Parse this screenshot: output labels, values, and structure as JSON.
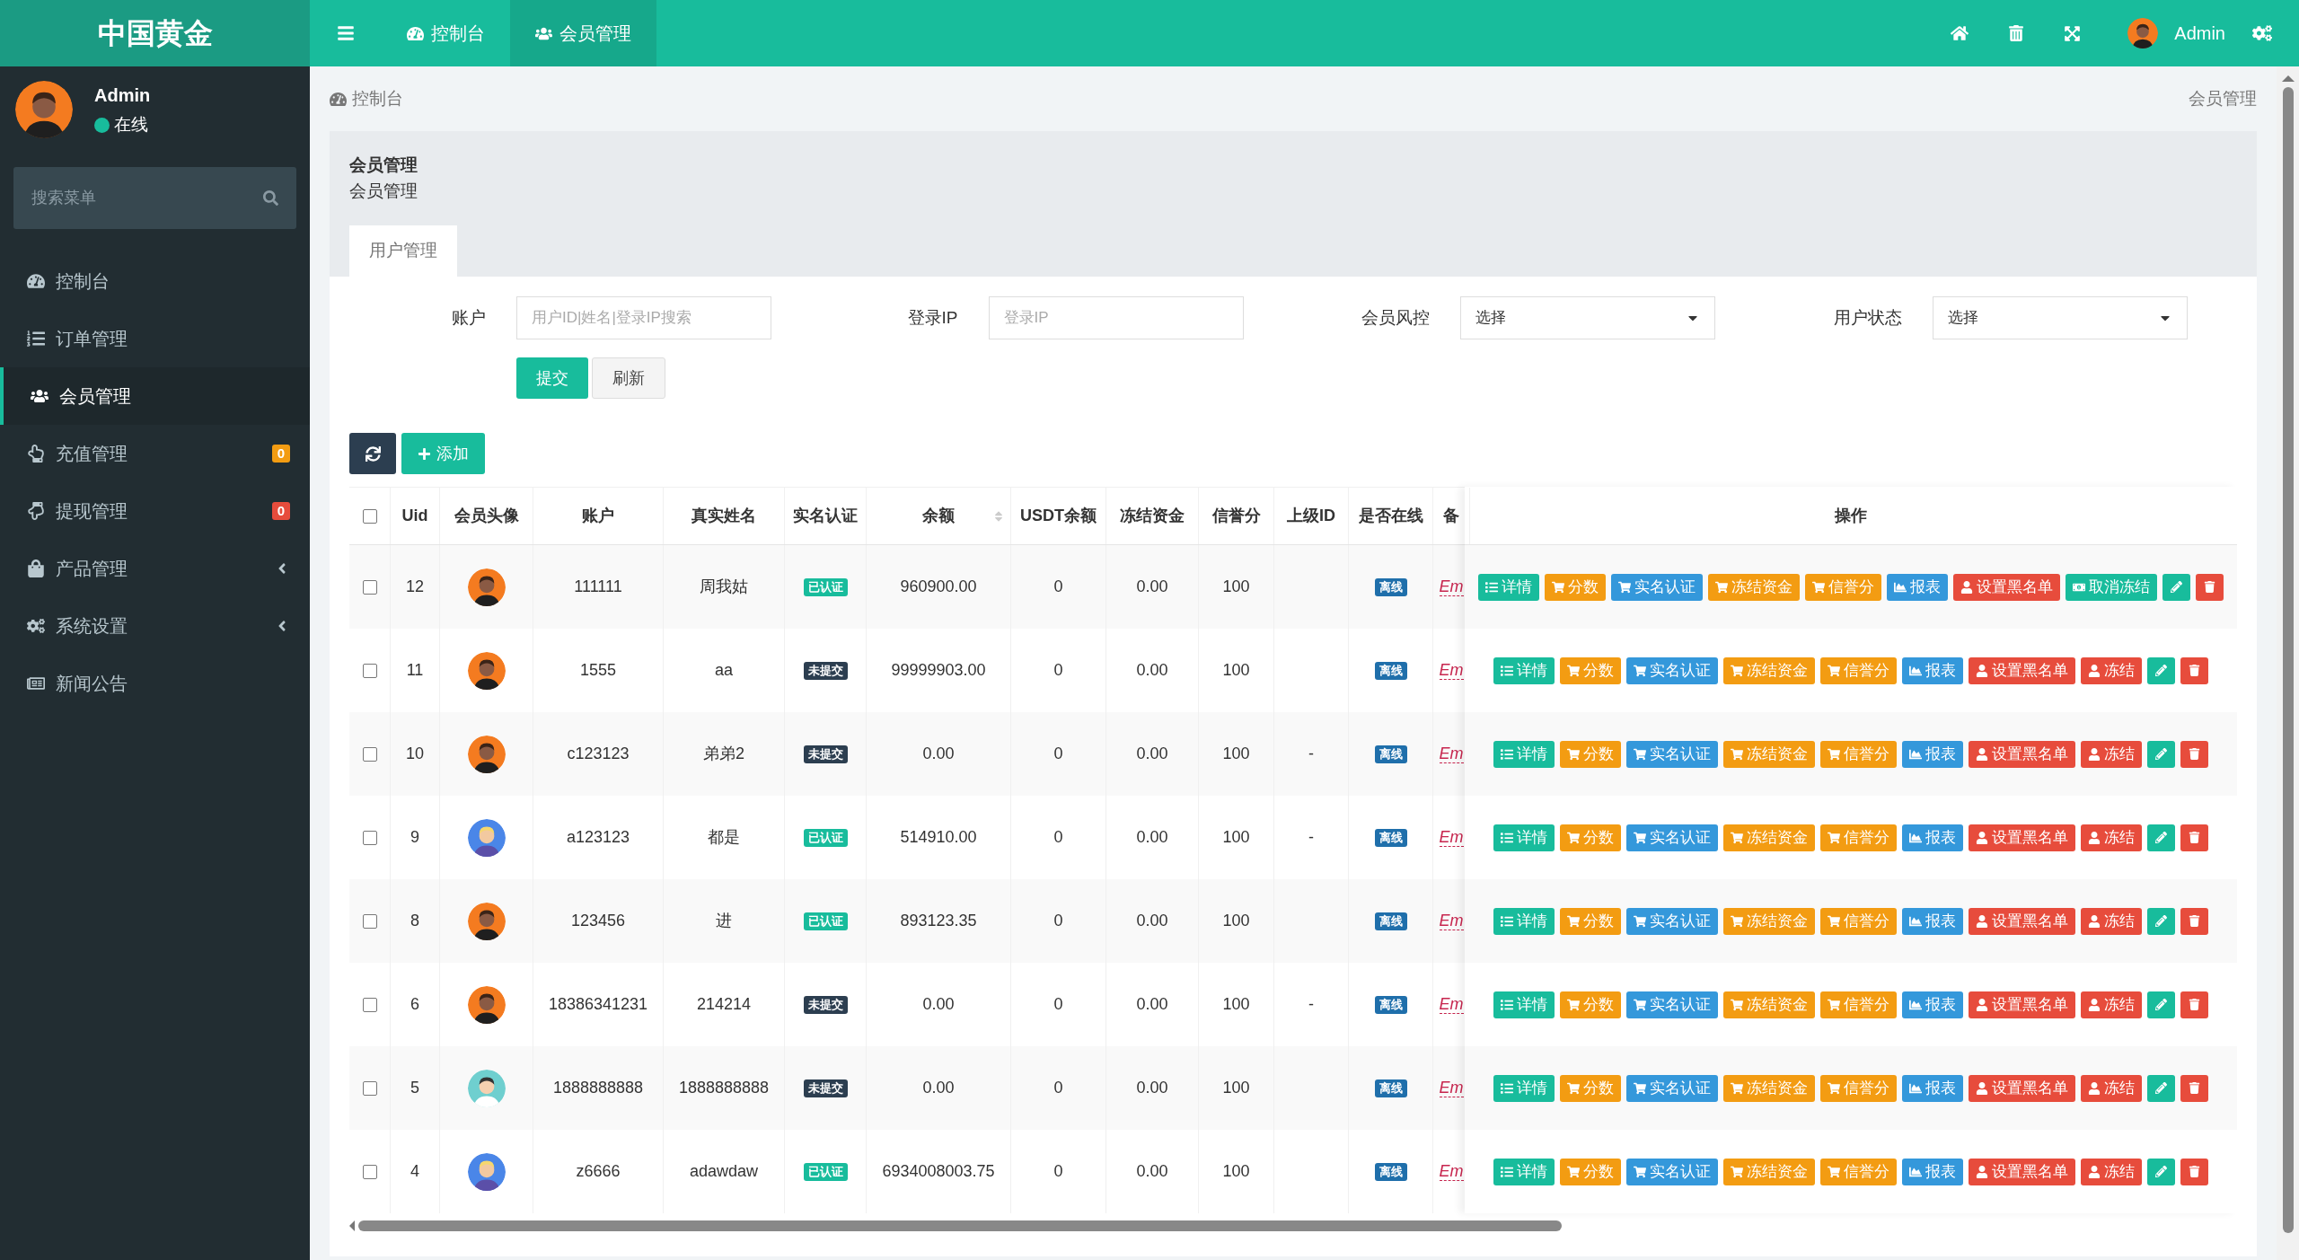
{
  "brand": "中国黄金",
  "topbar": {
    "tabs": [
      {
        "label": "控制台",
        "kind": "dashboard",
        "selected": false
      },
      {
        "label": "会员管理",
        "kind": "users",
        "selected": true
      }
    ],
    "user": {
      "name": "Admin"
    }
  },
  "sidebar": {
    "user": {
      "name": "Admin",
      "status": "在线"
    },
    "search": {
      "placeholder": "搜索菜单"
    },
    "items": [
      {
        "label": "控制台",
        "kind": "dashboard",
        "selected": false
      },
      {
        "label": "订单管理",
        "kind": "list",
        "selected": false
      },
      {
        "label": "会员管理",
        "kind": "users",
        "selected": true
      },
      {
        "label": "充值管理",
        "kind": "hand-up",
        "selected": false,
        "badge": "0",
        "color": "#f39c12"
      },
      {
        "label": "提现管理",
        "kind": "hand-down",
        "selected": false,
        "badge": "0",
        "color": "#e74c3c"
      },
      {
        "label": "产品管理",
        "kind": "bag",
        "selected": false,
        "expandable": true
      },
      {
        "label": "系统设置",
        "kind": "cogs",
        "selected": false,
        "expandable": true
      },
      {
        "label": "新闻公告",
        "kind": "news",
        "selected": false
      }
    ]
  },
  "breadcrumb": {
    "left": "控制台",
    "right": "会员管理"
  },
  "panel": {
    "title": "会员管理",
    "subtitle": "会员管理",
    "tabs": [
      {
        "label": "用户管理",
        "selected": true
      }
    ]
  },
  "filters": [
    {
      "label": "账户",
      "kind": "input",
      "placeholder": "用户ID|姓名|登录IP搜索"
    },
    {
      "label": "登录IP",
      "kind": "input",
      "placeholder": "登录IP"
    },
    {
      "label": "会员风控",
      "kind": "select",
      "value": "选择"
    },
    {
      "label": "用户状态",
      "kind": "select",
      "value": "选择"
    }
  ],
  "form_buttons": [
    {
      "label": "提交",
      "kind": "primary"
    },
    {
      "label": "刷新",
      "kind": "default"
    }
  ],
  "toolbar": {
    "add_label": "添加"
  },
  "table": {
    "all_checked": false,
    "columns": [
      {
        "label": "Uid"
      },
      {
        "label": "会员头像"
      },
      {
        "label": "账户"
      },
      {
        "label": "真实姓名"
      },
      {
        "label": "实名认证"
      },
      {
        "label": "余额",
        "sortable": true
      },
      {
        "label": "USDT余额"
      },
      {
        "label": "冻结资金"
      },
      {
        "label": "信誉分"
      },
      {
        "label": "上级ID"
      },
      {
        "label": "是否在线"
      },
      {
        "label": "备"
      }
    ],
    "ops_column": "操作",
    "rows": [
      {
        "checked": false,
        "uid": "12",
        "avatar": {
          "kind": "orange"
        },
        "account": "111111",
        "name": "周我姑",
        "verify": {
          "label": "已认证",
          "kind": "verified"
        },
        "balance": "960900.00",
        "usdt": "0",
        "frozen": "0.00",
        "credit": "100",
        "online": "离线",
        "remark": "Em",
        "actions": [
          {
            "label": "详情",
            "kind": "detail"
          },
          {
            "label": "分数",
            "kind": "cart-orange"
          },
          {
            "label": "实名认证",
            "kind": "cart-blue"
          },
          {
            "label": "冻结资金",
            "kind": "cart-orange"
          },
          {
            "label": "信誉分",
            "kind": "cart-orange"
          },
          {
            "label": "报表",
            "kind": "chart"
          },
          {
            "label": "设置黑名单",
            "kind": "user-red"
          },
          {
            "label": "取消冻结",
            "kind": "unfreeze"
          }
        ]
      },
      {
        "checked": false,
        "uid": "11",
        "avatar": {
          "kind": "orange"
        },
        "account": "1555",
        "name": "aa",
        "verify": {
          "label": "未提交",
          "kind": "pending"
        },
        "balance": "99999903.00",
        "usdt": "0",
        "frozen": "0.00",
        "credit": "100",
        "online": "离线",
        "remark": "Em",
        "actions": [
          {
            "label": "详情",
            "kind": "detail"
          },
          {
            "label": "分数",
            "kind": "cart-orange"
          },
          {
            "label": "实名认证",
            "kind": "cart-blue"
          },
          {
            "label": "冻结资金",
            "kind": "cart-orange"
          },
          {
            "label": "信誉分",
            "kind": "cart-orange"
          },
          {
            "label": "报表",
            "kind": "chart"
          },
          {
            "label": "设置黑名单",
            "kind": "user-red"
          },
          {
            "label": "冻结",
            "kind": "user-red"
          }
        ]
      },
      {
        "checked": false,
        "uid": "10",
        "avatar": {
          "kind": "orange"
        },
        "account": "c123123",
        "name": "弟弟2",
        "verify": {
          "label": "未提交",
          "kind": "pending"
        },
        "balance": "0.00",
        "usdt": "0",
        "frozen": "0.00",
        "credit": "100",
        "parent_id": "-",
        "online": "离线",
        "remark": "Em",
        "actions": [
          {
            "label": "详情",
            "kind": "detail"
          },
          {
            "label": "分数",
            "kind": "cart-orange"
          },
          {
            "label": "实名认证",
            "kind": "cart-blue"
          },
          {
            "label": "冻结资金",
            "kind": "cart-orange"
          },
          {
            "label": "信誉分",
            "kind": "cart-orange"
          },
          {
            "label": "报表",
            "kind": "chart"
          },
          {
            "label": "设置黑名单",
            "kind": "user-red"
          },
          {
            "label": "冻结",
            "kind": "user-red"
          }
        ]
      },
      {
        "checked": false,
        "uid": "9",
        "avatar": {
          "kind": "blue"
        },
        "account": "a123123",
        "name": "都是",
        "verify": {
          "label": "已认证",
          "kind": "verified"
        },
        "balance": "514910.00",
        "usdt": "0",
        "frozen": "0.00",
        "credit": "100",
        "parent_id": "-",
        "online": "离线",
        "remark": "Em",
        "actions": [
          {
            "label": "详情",
            "kind": "detail"
          },
          {
            "label": "分数",
            "kind": "cart-orange"
          },
          {
            "label": "实名认证",
            "kind": "cart-blue"
          },
          {
            "label": "冻结资金",
            "kind": "cart-orange"
          },
          {
            "label": "信誉分",
            "kind": "cart-orange"
          },
          {
            "label": "报表",
            "kind": "chart"
          },
          {
            "label": "设置黑名单",
            "kind": "user-red"
          },
          {
            "label": "冻结",
            "kind": "user-red"
          }
        ]
      },
      {
        "checked": false,
        "uid": "8",
        "avatar": {
          "kind": "orange"
        },
        "account": "123456",
        "name": "进",
        "verify": {
          "label": "已认证",
          "kind": "verified"
        },
        "balance": "893123.35",
        "usdt": "0",
        "frozen": "0.00",
        "credit": "100",
        "online": "离线",
        "remark": "Em",
        "actions": [
          {
            "label": "详情",
            "kind": "detail"
          },
          {
            "label": "分数",
            "kind": "cart-orange"
          },
          {
            "label": "实名认证",
            "kind": "cart-blue"
          },
          {
            "label": "冻结资金",
            "kind": "cart-orange"
          },
          {
            "label": "信誉分",
            "kind": "cart-orange"
          },
          {
            "label": "报表",
            "kind": "chart"
          },
          {
            "label": "设置黑名单",
            "kind": "user-red"
          },
          {
            "label": "冻结",
            "kind": "user-red"
          }
        ]
      },
      {
        "checked": false,
        "uid": "6",
        "avatar": {
          "kind": "orange"
        },
        "account": "18386341231",
        "name": "214214",
        "verify": {
          "label": "未提交",
          "kind": "pending"
        },
        "balance": "0.00",
        "usdt": "0",
        "frozen": "0.00",
        "credit": "100",
        "parent_id": "-",
        "online": "离线",
        "remark": "Em",
        "actions": [
          {
            "label": "详情",
            "kind": "detail"
          },
          {
            "label": "分数",
            "kind": "cart-orange"
          },
          {
            "label": "实名认证",
            "kind": "cart-blue"
          },
          {
            "label": "冻结资金",
            "kind": "cart-orange"
          },
          {
            "label": "信誉分",
            "kind": "cart-orange"
          },
          {
            "label": "报表",
            "kind": "chart"
          },
          {
            "label": "设置黑名单",
            "kind": "user-red"
          },
          {
            "label": "冻结",
            "kind": "user-red"
          }
        ]
      },
      {
        "checked": false,
        "uid": "5",
        "avatar": {
          "kind": "teal"
        },
        "account": "1888888888",
        "name": "1888888888",
        "verify": {
          "label": "未提交",
          "kind": "pending"
        },
        "balance": "0.00",
        "usdt": "0",
        "frozen": "0.00",
        "credit": "100",
        "online": "离线",
        "remark": "Em",
        "actions": [
          {
            "label": "详情",
            "kind": "detail"
          },
          {
            "label": "分数",
            "kind": "cart-orange"
          },
          {
            "label": "实名认证",
            "kind": "cart-blue"
          },
          {
            "label": "冻结资金",
            "kind": "cart-orange"
          },
          {
            "label": "信誉分",
            "kind": "cart-orange"
          },
          {
            "label": "报表",
            "kind": "chart"
          },
          {
            "label": "设置黑名单",
            "kind": "user-red"
          },
          {
            "label": "冻结",
            "kind": "user-red"
          }
        ]
      },
      {
        "checked": false,
        "uid": "4",
        "avatar": {
          "kind": "blue"
        },
        "account": "z6666",
        "name": "adawdaw",
        "verify": {
          "label": "已认证",
          "kind": "verified"
        },
        "balance": "6934008003.75",
        "usdt": "0",
        "frozen": "0.00",
        "credit": "100",
        "online": "离线",
        "remark": "Em",
        "actions": [
          {
            "label": "详情",
            "kind": "detail"
          },
          {
            "label": "分数",
            "kind": "cart-orange"
          },
          {
            "label": "实名认证",
            "kind": "cart-blue"
          },
          {
            "label": "冻结资金",
            "kind": "cart-orange"
          },
          {
            "label": "信誉分",
            "kind": "cart-orange"
          },
          {
            "label": "报表",
            "kind": "chart"
          },
          {
            "label": "设置黑名单",
            "kind": "user-red"
          },
          {
            "label": "冻结",
            "kind": "user-red"
          }
        ]
      }
    ]
  }
}
